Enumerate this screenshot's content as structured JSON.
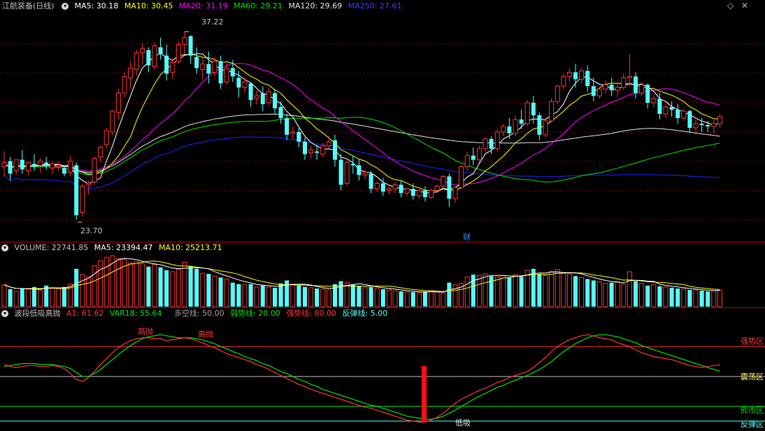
{
  "colors": {
    "up": "#ff3232",
    "down": "#54ffff",
    "ma5": "#ffffff",
    "ma10": "#ffff00",
    "ma20": "#ff00ff",
    "ma60": "#00e000",
    "ma120": "#e0e0e0",
    "ma250": "#2020ff",
    "grid": "#8b0000"
  },
  "price_header": {
    "title": "江航装备(日线)",
    "ma5": "MA5: 30.18",
    "ma10": "MA10: 30.45",
    "ma20": "MA20: 31.19",
    "ma60": "MA60: 29.21",
    "ma120": "MA120: 29.69",
    "ma250": "MA250: 27.61"
  },
  "price_annotations": {
    "high": "37.22",
    "low": "23.70",
    "finance_badge": "财"
  },
  "volume_header": {
    "title": "VOLUME: 22741.85",
    "ma5": "MA5: 23394.47",
    "ma10": "MA10: 25213.71"
  },
  "indicator_header": {
    "title": "波段低吸高抛",
    "a1": "A1: 61.62",
    "var18": "VAR18: 55.64",
    "line_long_short": "多空线: 50.00",
    "line_weak": "弱势线: 20.00",
    "line_strong": "强势线: 80.00",
    "line_rebound": "反弹线: 5.00"
  },
  "indicator_labels": {
    "strong_zone": "强势区",
    "oscillation_zone": "震荡区",
    "bear_zone": "熊市区",
    "rebound_zone": "反弹区",
    "sell_high_1": "高抛",
    "sell_high_2": "高抛",
    "buy_low": "低吸"
  },
  "icons": {
    "collapse": "chevron-down-icon",
    "diamond": "diamond-icon",
    "close": "close-icon"
  },
  "chart_data": [
    {
      "type": "candlestick",
      "title": "江航装备(日线)",
      "ylim": [
        22.5,
        38.5
      ],
      "annotations": [
        {
          "label": "37.22",
          "value": 37.22
        },
        {
          "label": "23.70",
          "value": 23.7
        }
      ],
      "series": [
        {
          "name": "MA5",
          "last": 30.18
        },
        {
          "name": "MA10",
          "last": 30.45
        },
        {
          "name": "MA20",
          "last": 31.19
        },
        {
          "name": "MA60",
          "last": 29.21
        },
        {
          "name": "MA120",
          "last": 29.69
        },
        {
          "name": "MA250",
          "last": 27.61
        }
      ],
      "candles": [
        [
          27.5,
          28.6,
          27.8,
          26.8
        ],
        [
          27.9,
          28.2,
          27.0,
          26.5
        ],
        [
          27.2,
          27.6,
          28.0,
          26.9
        ],
        [
          28.0,
          28.7,
          27.3,
          27.0
        ],
        [
          27.2,
          27.7,
          27.8,
          26.9
        ],
        [
          27.7,
          28.4,
          27.5,
          27.2
        ],
        [
          27.6,
          28.1,
          27.9,
          27.1
        ],
        [
          27.8,
          28.2,
          27.6,
          27.3
        ],
        [
          27.4,
          27.9,
          27.7,
          27.0
        ],
        [
          27.5,
          27.9,
          27.6,
          27.2
        ],
        [
          27.4,
          27.6,
          27.0,
          26.8
        ],
        [
          27.1,
          28.3,
          27.9,
          26.8
        ],
        [
          27.6,
          27.8,
          24.0,
          23.7
        ],
        [
          24.2,
          26.3,
          26.1,
          23.9
        ],
        [
          26.2,
          26.5,
          26.3,
          25.5
        ],
        [
          26.4,
          28.2,
          28.1,
          26.2
        ],
        [
          28.2,
          29.0,
          28.9,
          27.8
        ],
        [
          29.1,
          30.3,
          30.1,
          28.8
        ],
        [
          30.0,
          31.6,
          31.5,
          29.8
        ],
        [
          31.4,
          33.1,
          32.8,
          30.9
        ],
        [
          32.8,
          34.3,
          34.0,
          32.5
        ],
        [
          33.9,
          35.1,
          34.6,
          33.1
        ],
        [
          34.5,
          35.9,
          35.7,
          34.1
        ],
        [
          35.7,
          36.4,
          36.0,
          34.9
        ],
        [
          35.9,
          36.1,
          34.8,
          34.3
        ],
        [
          34.7,
          36.4,
          36.2,
          34.5
        ],
        [
          36.1,
          36.8,
          35.6,
          35.2
        ],
        [
          35.5,
          36.3,
          34.2,
          33.7
        ],
        [
          34.3,
          35.3,
          35.0,
          33.8
        ],
        [
          35.1,
          36.5,
          36.3,
          34.9
        ],
        [
          36.3,
          37.22,
          36.8,
          35.6
        ],
        [
          36.9,
          37.0,
          35.5,
          34.9
        ],
        [
          35.4,
          36.1,
          34.6,
          34.2
        ],
        [
          34.5,
          35.4,
          34.9,
          33.8
        ],
        [
          34.9,
          35.8,
          34.2,
          33.5
        ],
        [
          34.3,
          35.4,
          35.1,
          34.0
        ],
        [
          35.1,
          35.5,
          33.5,
          33.1
        ],
        [
          33.6,
          34.9,
          34.6,
          33.4
        ],
        [
          34.6,
          35.2,
          34.0,
          33.6
        ],
        [
          33.9,
          34.4,
          33.2,
          32.5
        ],
        [
          33.2,
          33.9,
          33.6,
          32.8
        ],
        [
          33.5,
          33.6,
          32.3,
          31.8
        ],
        [
          32.4,
          33.0,
          32.6,
          32.0
        ],
        [
          32.8,
          33.3,
          32.0,
          31.5
        ],
        [
          32.1,
          33.2,
          32.9,
          31.9
        ],
        [
          32.8,
          33.1,
          31.7,
          31.3
        ],
        [
          31.8,
          32.2,
          31.0,
          30.6
        ],
        [
          31.0,
          31.3,
          29.8,
          29.4
        ],
        [
          29.9,
          30.4,
          30.0,
          29.5
        ],
        [
          30.0,
          30.3,
          29.3,
          28.9
        ],
        [
          29.3,
          29.6,
          28.4,
          28.0
        ],
        [
          28.5,
          29.0,
          28.7,
          28.1
        ],
        [
          28.6,
          29.1,
          28.5,
          28.0
        ],
        [
          28.4,
          29.2,
          29.0,
          28.2
        ],
        [
          29.0,
          29.7,
          29.3,
          28.8
        ],
        [
          29.4,
          29.8,
          28.0,
          27.5
        ],
        [
          28.0,
          28.4,
          26.2,
          25.8
        ],
        [
          26.3,
          27.9,
          27.8,
          26.1
        ],
        [
          27.7,
          28.3,
          27.6,
          27.0
        ],
        [
          27.6,
          28.0,
          26.9,
          26.5
        ],
        [
          26.9,
          27.3,
          27.1,
          26.6
        ],
        [
          27.0,
          27.2,
          25.9,
          25.6
        ],
        [
          25.9,
          26.4,
          26.3,
          25.7
        ],
        [
          26.3,
          26.7,
          25.7,
          25.4
        ],
        [
          25.8,
          26.2,
          25.9,
          25.5
        ],
        [
          25.9,
          26.4,
          26.2,
          25.6
        ],
        [
          26.2,
          26.5,
          25.6,
          25.3
        ],
        [
          25.6,
          26.0,
          25.9,
          25.4
        ],
        [
          25.9,
          26.3,
          25.4,
          25.1
        ],
        [
          25.4,
          25.9,
          25.8,
          25.2
        ],
        [
          25.8,
          26.1,
          25.3,
          25.0
        ],
        [
          25.3,
          25.9,
          25.8,
          25.2
        ],
        [
          25.8,
          26.2,
          26.1,
          25.6
        ],
        [
          26.1,
          26.9,
          26.8,
          25.8
        ],
        [
          26.8,
          27.0,
          25.2,
          24.6
        ],
        [
          25.2,
          26.1,
          26.0,
          24.9
        ],
        [
          26.0,
          27.6,
          27.5,
          25.9
        ],
        [
          27.5,
          28.6,
          28.3,
          27.2
        ],
        [
          28.3,
          28.9,
          28.0,
          27.6
        ],
        [
          28.0,
          29.0,
          28.8,
          27.8
        ],
        [
          28.8,
          29.6,
          29.5,
          28.6
        ],
        [
          29.5,
          29.7,
          28.8,
          28.4
        ],
        [
          28.8,
          30.2,
          30.0,
          28.6
        ],
        [
          30.0,
          30.6,
          30.4,
          29.7
        ],
        [
          30.4,
          31.0,
          29.9,
          29.5
        ],
        [
          29.9,
          31.2,
          30.9,
          29.7
        ],
        [
          30.9,
          31.6,
          30.6,
          30.2
        ],
        [
          30.6,
          32.3,
          32.1,
          30.4
        ],
        [
          32.1,
          32.6,
          31.2,
          30.6
        ],
        [
          31.2,
          31.4,
          29.8,
          29.4
        ],
        [
          29.8,
          31.0,
          30.8,
          29.6
        ],
        [
          30.8,
          32.4,
          32.2,
          30.7
        ],
        [
          32.2,
          33.4,
          33.3,
          32.0
        ],
        [
          33.3,
          34.2,
          34.0,
          33.1
        ],
        [
          34.0,
          34.6,
          34.3,
          33.6
        ],
        [
          34.3,
          34.9,
          33.8,
          33.2
        ],
        [
          33.8,
          34.6,
          34.4,
          33.5
        ],
        [
          34.4,
          34.8,
          33.3,
          32.9
        ],
        [
          33.3,
          33.9,
          32.6,
          32.2
        ],
        [
          32.6,
          33.2,
          33.1,
          32.4
        ],
        [
          33.1,
          33.7,
          33.4,
          32.8
        ],
        [
          33.4,
          33.9,
          33.0,
          32.6
        ],
        [
          33.0,
          33.5,
          33.2,
          32.5
        ],
        [
          33.2,
          34.2,
          33.9,
          33.0
        ],
        [
          33.9,
          35.6,
          34.0,
          33.3
        ],
        [
          34.0,
          34.3,
          32.8,
          32.4
        ],
        [
          32.8,
          33.6,
          33.4,
          32.6
        ],
        [
          33.4,
          33.5,
          32.1,
          31.7
        ],
        [
          32.1,
          32.6,
          32.4,
          31.8
        ],
        [
          32.4,
          32.8,
          31.3,
          30.9
        ],
        [
          31.3,
          32.0,
          31.8,
          31.0
        ],
        [
          31.8,
          32.2,
          31.6,
          31.1
        ],
        [
          31.6,
          32.0,
          31.0,
          30.6
        ],
        [
          31.0,
          31.7,
          31.5,
          30.8
        ],
        [
          31.5,
          31.6,
          30.3,
          29.9
        ],
        [
          30.3,
          30.9,
          30.6,
          29.8
        ],
        [
          30.6,
          31.0,
          30.5,
          30.0
        ],
        [
          30.5,
          30.8,
          30.4,
          30.0
        ],
        [
          30.4,
          30.9,
          30.6,
          29.9
        ],
        [
          30.6,
          31.3,
          31.1,
          30.3
        ]
      ]
    },
    {
      "type": "bar",
      "title": "VOLUME: 22741.85",
      "series": [
        {
          "name": "MA5",
          "last": 23394.47
        },
        {
          "name": "MA10",
          "last": 25213.71
        }
      ],
      "values": [
        30000,
        24000,
        21000,
        25000,
        24000,
        27000,
        23000,
        29000,
        26000,
        24000,
        27000,
        31000,
        52000,
        44000,
        41000,
        56000,
        63000,
        68000,
        70000,
        66000,
        65000,
        60000,
        62000,
        59000,
        55000,
        58000,
        54000,
        50000,
        48000,
        51000,
        61000,
        56000,
        52000,
        46000,
        45000,
        42000,
        40000,
        38000,
        33000,
        31000,
        30000,
        31000,
        27000,
        29000,
        27000,
        26000,
        32000,
        36000,
        31000,
        29000,
        27000,
        26000,
        25000,
        24000,
        23000,
        31000,
        35000,
        33000,
        30000,
        28000,
        26000,
        27000,
        25000,
        24000,
        23000,
        22000,
        21000,
        20000,
        20000,
        19000,
        21000,
        22000,
        20000,
        19000,
        33000,
        30000,
        32000,
        41000,
        44000,
        43000,
        45000,
        42000,
        41000,
        43000,
        40000,
        44000,
        41000,
        50000,
        52000,
        45000,
        43000,
        48000,
        51000,
        47000,
        45000,
        42000,
        40000,
        38000,
        36000,
        34000,
        32000,
        33000,
        34000,
        31000,
        48000,
        35000,
        32000,
        29000,
        30000,
        28000,
        27000,
        26000,
        25000,
        24000,
        23000,
        23000,
        22000,
        21000,
        22000,
        22741.85
      ]
    },
    {
      "type": "line",
      "title": "波段低吸高抛",
      "ylim": [
        0,
        100
      ],
      "reference_lines": [
        {
          "name": "强势线",
          "value": 80
        },
        {
          "name": "多空线",
          "value": 50
        },
        {
          "name": "弱势线",
          "value": 20
        },
        {
          "name": "反弹线",
          "value": 5
        }
      ],
      "series": [
        {
          "name": "A1",
          "last": 61.62,
          "values": [
            62,
            60,
            59,
            60,
            61,
            61,
            60,
            60,
            61,
            60,
            58,
            53,
            47,
            45,
            49,
            55,
            62,
            68,
            74,
            79,
            83,
            86,
            88,
            89,
            89,
            88,
            88,
            86,
            87,
            88,
            89,
            88,
            86,
            84,
            81,
            79,
            76,
            73,
            71,
            69,
            67,
            65,
            62,
            60,
            57,
            54,
            51,
            48,
            45,
            42,
            40,
            37,
            35,
            33,
            31,
            29,
            27,
            25,
            23,
            21,
            19,
            18,
            16,
            14,
            12,
            10,
            8,
            6,
            5,
            4,
            4,
            6,
            9,
            13,
            18,
            23,
            27,
            30,
            33,
            36,
            38,
            41,
            44,
            46,
            49,
            51,
            53,
            55,
            59,
            64,
            69,
            75,
            80,
            84,
            87,
            89,
            91,
            92,
            91,
            89,
            88,
            87,
            84,
            82,
            80,
            77,
            74,
            72,
            70,
            69,
            68,
            67,
            65,
            63,
            61,
            60,
            59,
            60,
            61,
            61.62
          ]
        },
        {
          "name": "VAR18",
          "last": 55.64,
          "values": [
            60,
            61,
            62,
            63,
            63,
            63,
            62,
            62,
            62,
            61,
            60,
            58,
            54,
            50,
            50,
            53,
            57,
            62,
            67,
            72,
            77,
            81,
            85,
            88,
            90,
            91,
            92,
            91,
            90,
            89,
            89,
            89,
            88,
            87,
            85,
            83,
            80,
            78,
            75,
            73,
            70,
            68,
            66,
            63,
            61,
            58,
            55,
            53,
            50,
            47,
            45,
            42,
            40,
            37,
            35,
            33,
            31,
            29,
            27,
            25,
            23,
            21,
            20,
            18,
            16,
            14,
            12,
            10,
            9,
            8,
            7,
            7,
            8,
            10,
            13,
            16,
            20,
            23,
            27,
            30,
            33,
            36,
            39,
            41,
            44,
            46,
            49,
            51,
            54,
            57,
            61,
            65,
            70,
            75,
            79,
            83,
            86,
            89,
            91,
            92,
            92,
            91,
            90,
            88,
            86,
            84,
            81,
            79,
            77,
            75,
            73,
            71,
            69,
            67,
            65,
            63,
            61,
            59,
            57,
            55.64
          ]
        }
      ],
      "signals": [
        {
          "label": "高抛",
          "index": 22
        },
        {
          "label": "高抛",
          "index": 30
        },
        {
          "label": "低吸",
          "index": 70
        }
      ]
    }
  ]
}
